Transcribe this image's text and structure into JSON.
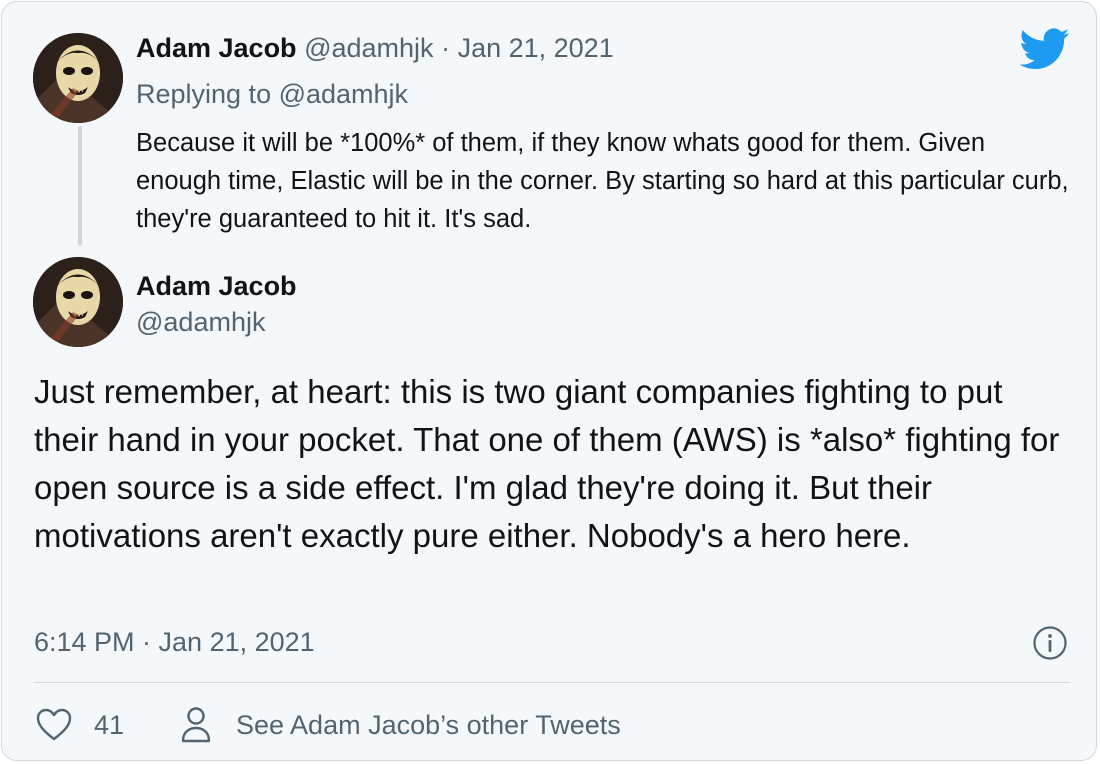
{
  "reply_tweet": {
    "author_name": "Adam Jacob",
    "author_handle": "@adamhjk",
    "separator": "·",
    "date": "Jan 21, 2021",
    "replying_to": "Replying to @adamhjk",
    "text": "Because it will be *100%* of them, if they know whats good for them. Given enough time, Elastic will be in the corner. By starting so hard at this particular curb, they're guaranteed to hit it. It's sad."
  },
  "main_tweet": {
    "author_name": "Adam Jacob",
    "author_handle": "@adamhjk",
    "text": "Just remember, at heart: this is two giant companies fighting to put their hand in your pocket. That one of them (AWS) is *also* fighting for open source is a side effect. I'm glad they're doing it. But their motivations aren't exactly pure either. Nobody's a hero here.",
    "timestamp": "6:14 PM · Jan 21, 2021"
  },
  "actions": {
    "like_count": "41",
    "see_other_tweets": "See Adam Jacob’s other Tweets"
  },
  "icons": {
    "brand": "twitter-bird-icon",
    "like": "heart-icon",
    "profile": "person-icon",
    "info": "info-icon"
  },
  "colors": {
    "background": "#f5f8fa",
    "text": "#0f1419",
    "muted": "#536471",
    "border": "#cfd9de",
    "brand_blue": "#1d9bf0"
  }
}
